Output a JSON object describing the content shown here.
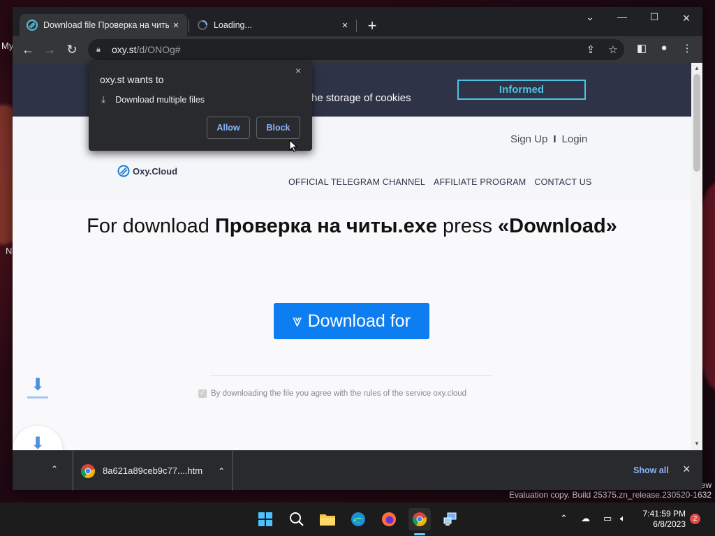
{
  "desktop": {
    "label_top": "My",
    "label_mid": "N",
    "eval_line1": "ew",
    "eval_line2": "Evaluation copy. Build 25375.zn_release.230520-1632"
  },
  "browser": {
    "tabs": [
      {
        "title": "Download file Проверка на читы",
        "close": "×"
      },
      {
        "title": "Loading...",
        "close": "×"
      }
    ],
    "new_tab": "+",
    "url_host": "oxy.st",
    "url_path": "/d/ONOg#"
  },
  "permission_popup": {
    "title": "oxy.st wants to",
    "permission": "Download multiple files",
    "allow_label": "Allow",
    "block_label": "Block",
    "close": "×"
  },
  "page": {
    "cookie_text": "he storage of cookies",
    "informed_label": "Informed",
    "sign_up": "Sign Up",
    "login": "Login",
    "logo_text": "Oxy.Cloud",
    "nav": [
      "OFFICIAL TELEGRAM CHANNEL",
      "AFFILIATE PROGRAM",
      "CONTACT US"
    ],
    "headline_pre": "For download ",
    "headline_file": "Проверка на читы.exe",
    "headline_mid": " press ",
    "headline_action": "«Download»",
    "download_label": "Download for",
    "agree_text": "By downloading the file you agree with the rules of the service oxy.cloud"
  },
  "download_shelf": {
    "file_name": "8a621a89ceb9c77....htm",
    "show_all": "Show all",
    "close": "×"
  },
  "taskbar": {
    "time": "7:41:59 PM",
    "date": "6/8/2023",
    "notification_count": "2",
    "apps": [
      "windows-start-icon",
      "search-icon",
      "file-explorer-icon",
      "edge-icon",
      "firefox-icon",
      "chrome-icon",
      "network-app-icon"
    ]
  },
  "colors": {
    "accent_blue": "#0d7df2",
    "cookie_bar": "#2e3347",
    "informed": "#4ec3e0",
    "chrome_dark": "#202124"
  }
}
